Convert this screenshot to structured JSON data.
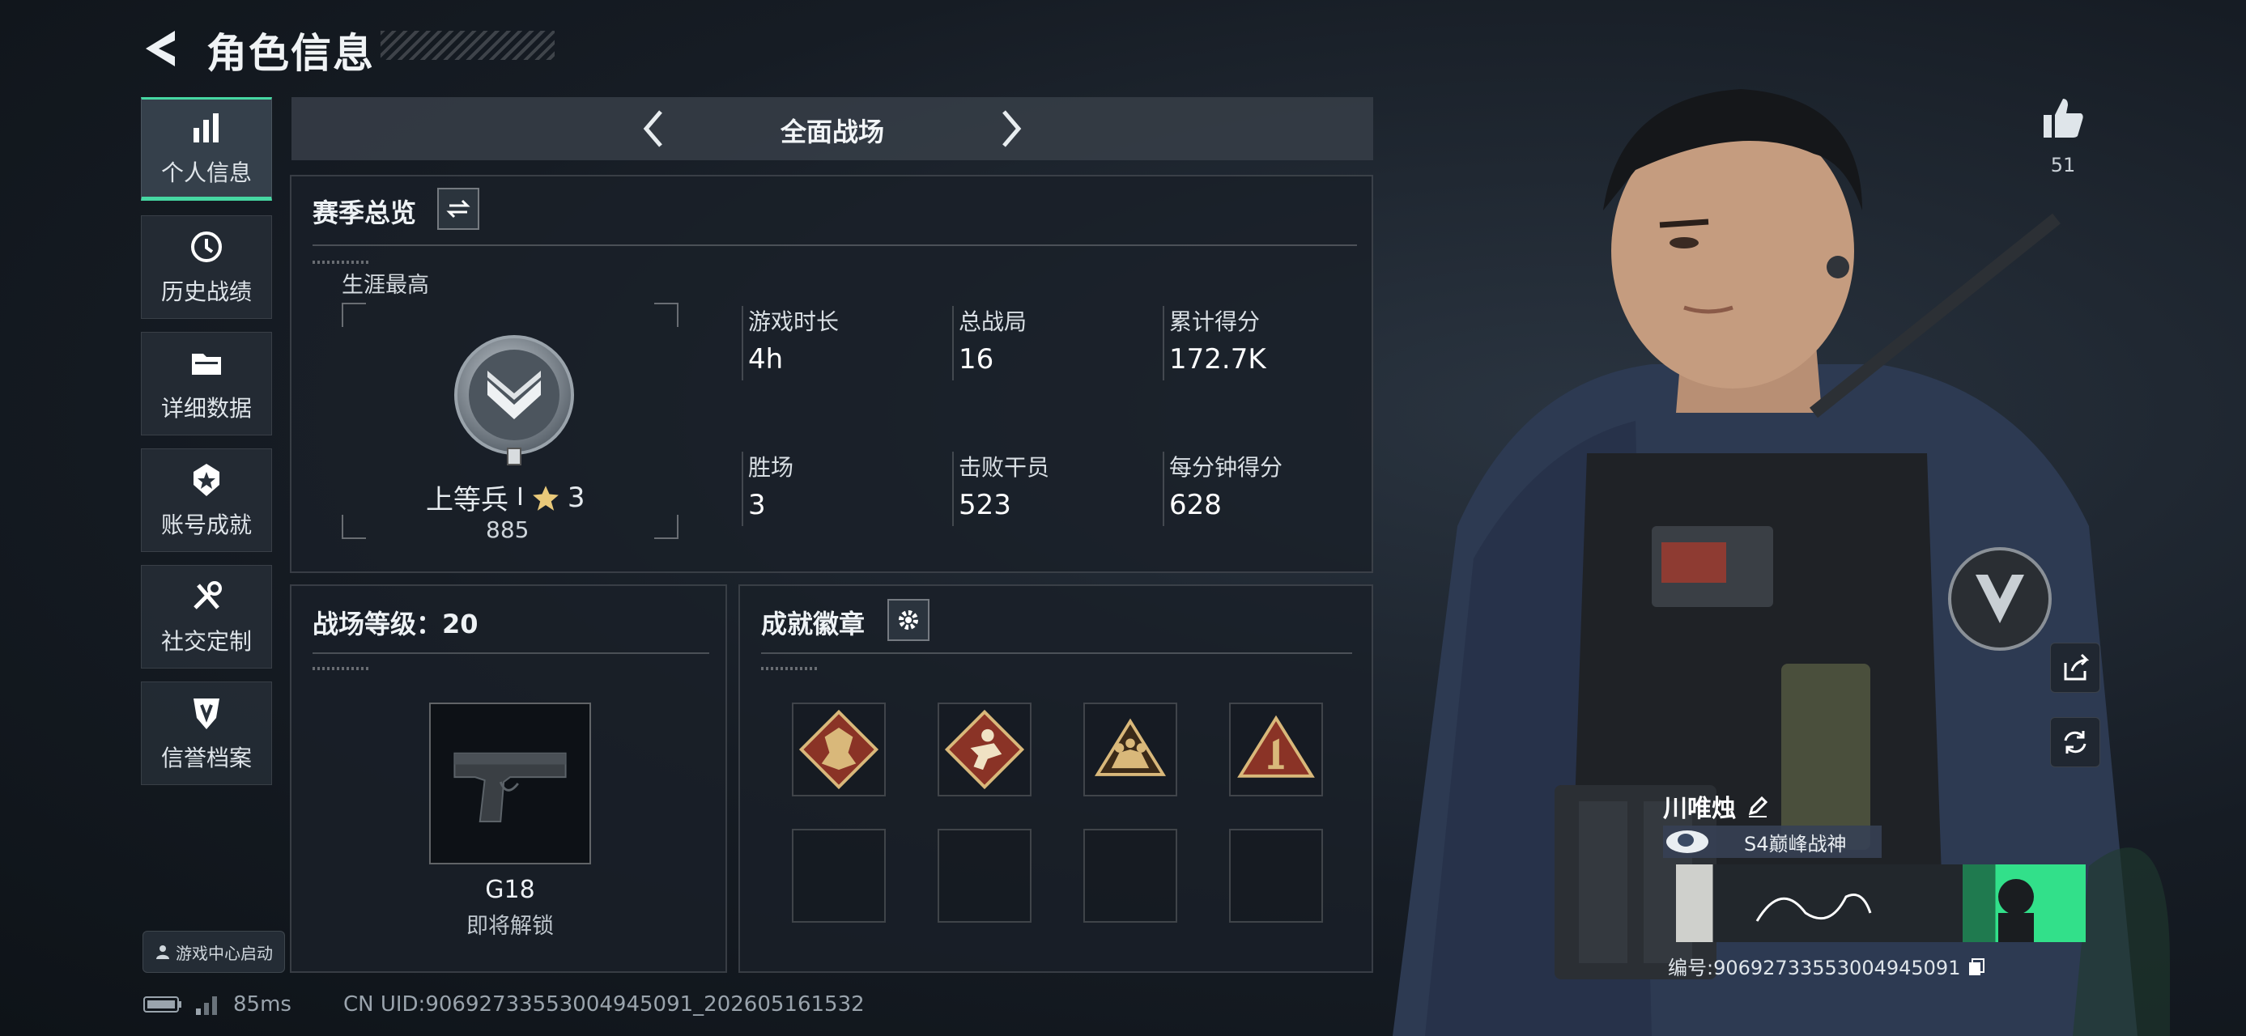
{
  "header": {
    "title": "角色信息"
  },
  "sidebar": {
    "items": [
      {
        "label": "个人信息",
        "icon": "bar-chart-icon",
        "active": true
      },
      {
        "label": "历史战绩",
        "icon": "history-icon"
      },
      {
        "label": "详细数据",
        "icon": "folder-icon"
      },
      {
        "label": "账号成就",
        "icon": "achievement-icon"
      },
      {
        "label": "社交定制",
        "icon": "tools-icon"
      },
      {
        "label": "信誉档案",
        "icon": "shield-icon"
      }
    ],
    "game_center": "游戏中心启动"
  },
  "mode": {
    "label": "全面战场"
  },
  "season": {
    "title": "赛季总览",
    "career_label": "生涯最高",
    "rank_name": "上等兵",
    "rank_tier": "Ⅰ",
    "stars": "3",
    "rank_points": "885",
    "stats": [
      {
        "label": "游戏时长",
        "value": "4h"
      },
      {
        "label": "总战局",
        "value": "16"
      },
      {
        "label": "累计得分",
        "value": "172.7K"
      },
      {
        "label": "胜场",
        "value": "3"
      },
      {
        "label": "击败干员",
        "value": "523"
      },
      {
        "label": "每分钟得分",
        "value": "628"
      }
    ]
  },
  "battlefield_level": {
    "title": "战场等级：20",
    "weapon_name": "G18",
    "weapon_status": "即将解锁"
  },
  "badges": {
    "title": "成就徽章",
    "unlocked_count": 4,
    "total_slots": 8
  },
  "profile": {
    "likes": "51",
    "player_name": "川唯烛",
    "title_tag": "S4巅峰战神",
    "player_number": "编号:9069273355300494​5091"
  },
  "status_bar": {
    "ping": "85ms",
    "uid": "CN UID:9069273355300494​5091_202605161532"
  },
  "colors": {
    "accent": "#46d7a2",
    "badge_gold": "#d9b87a",
    "badge_red": "#8a3326"
  }
}
